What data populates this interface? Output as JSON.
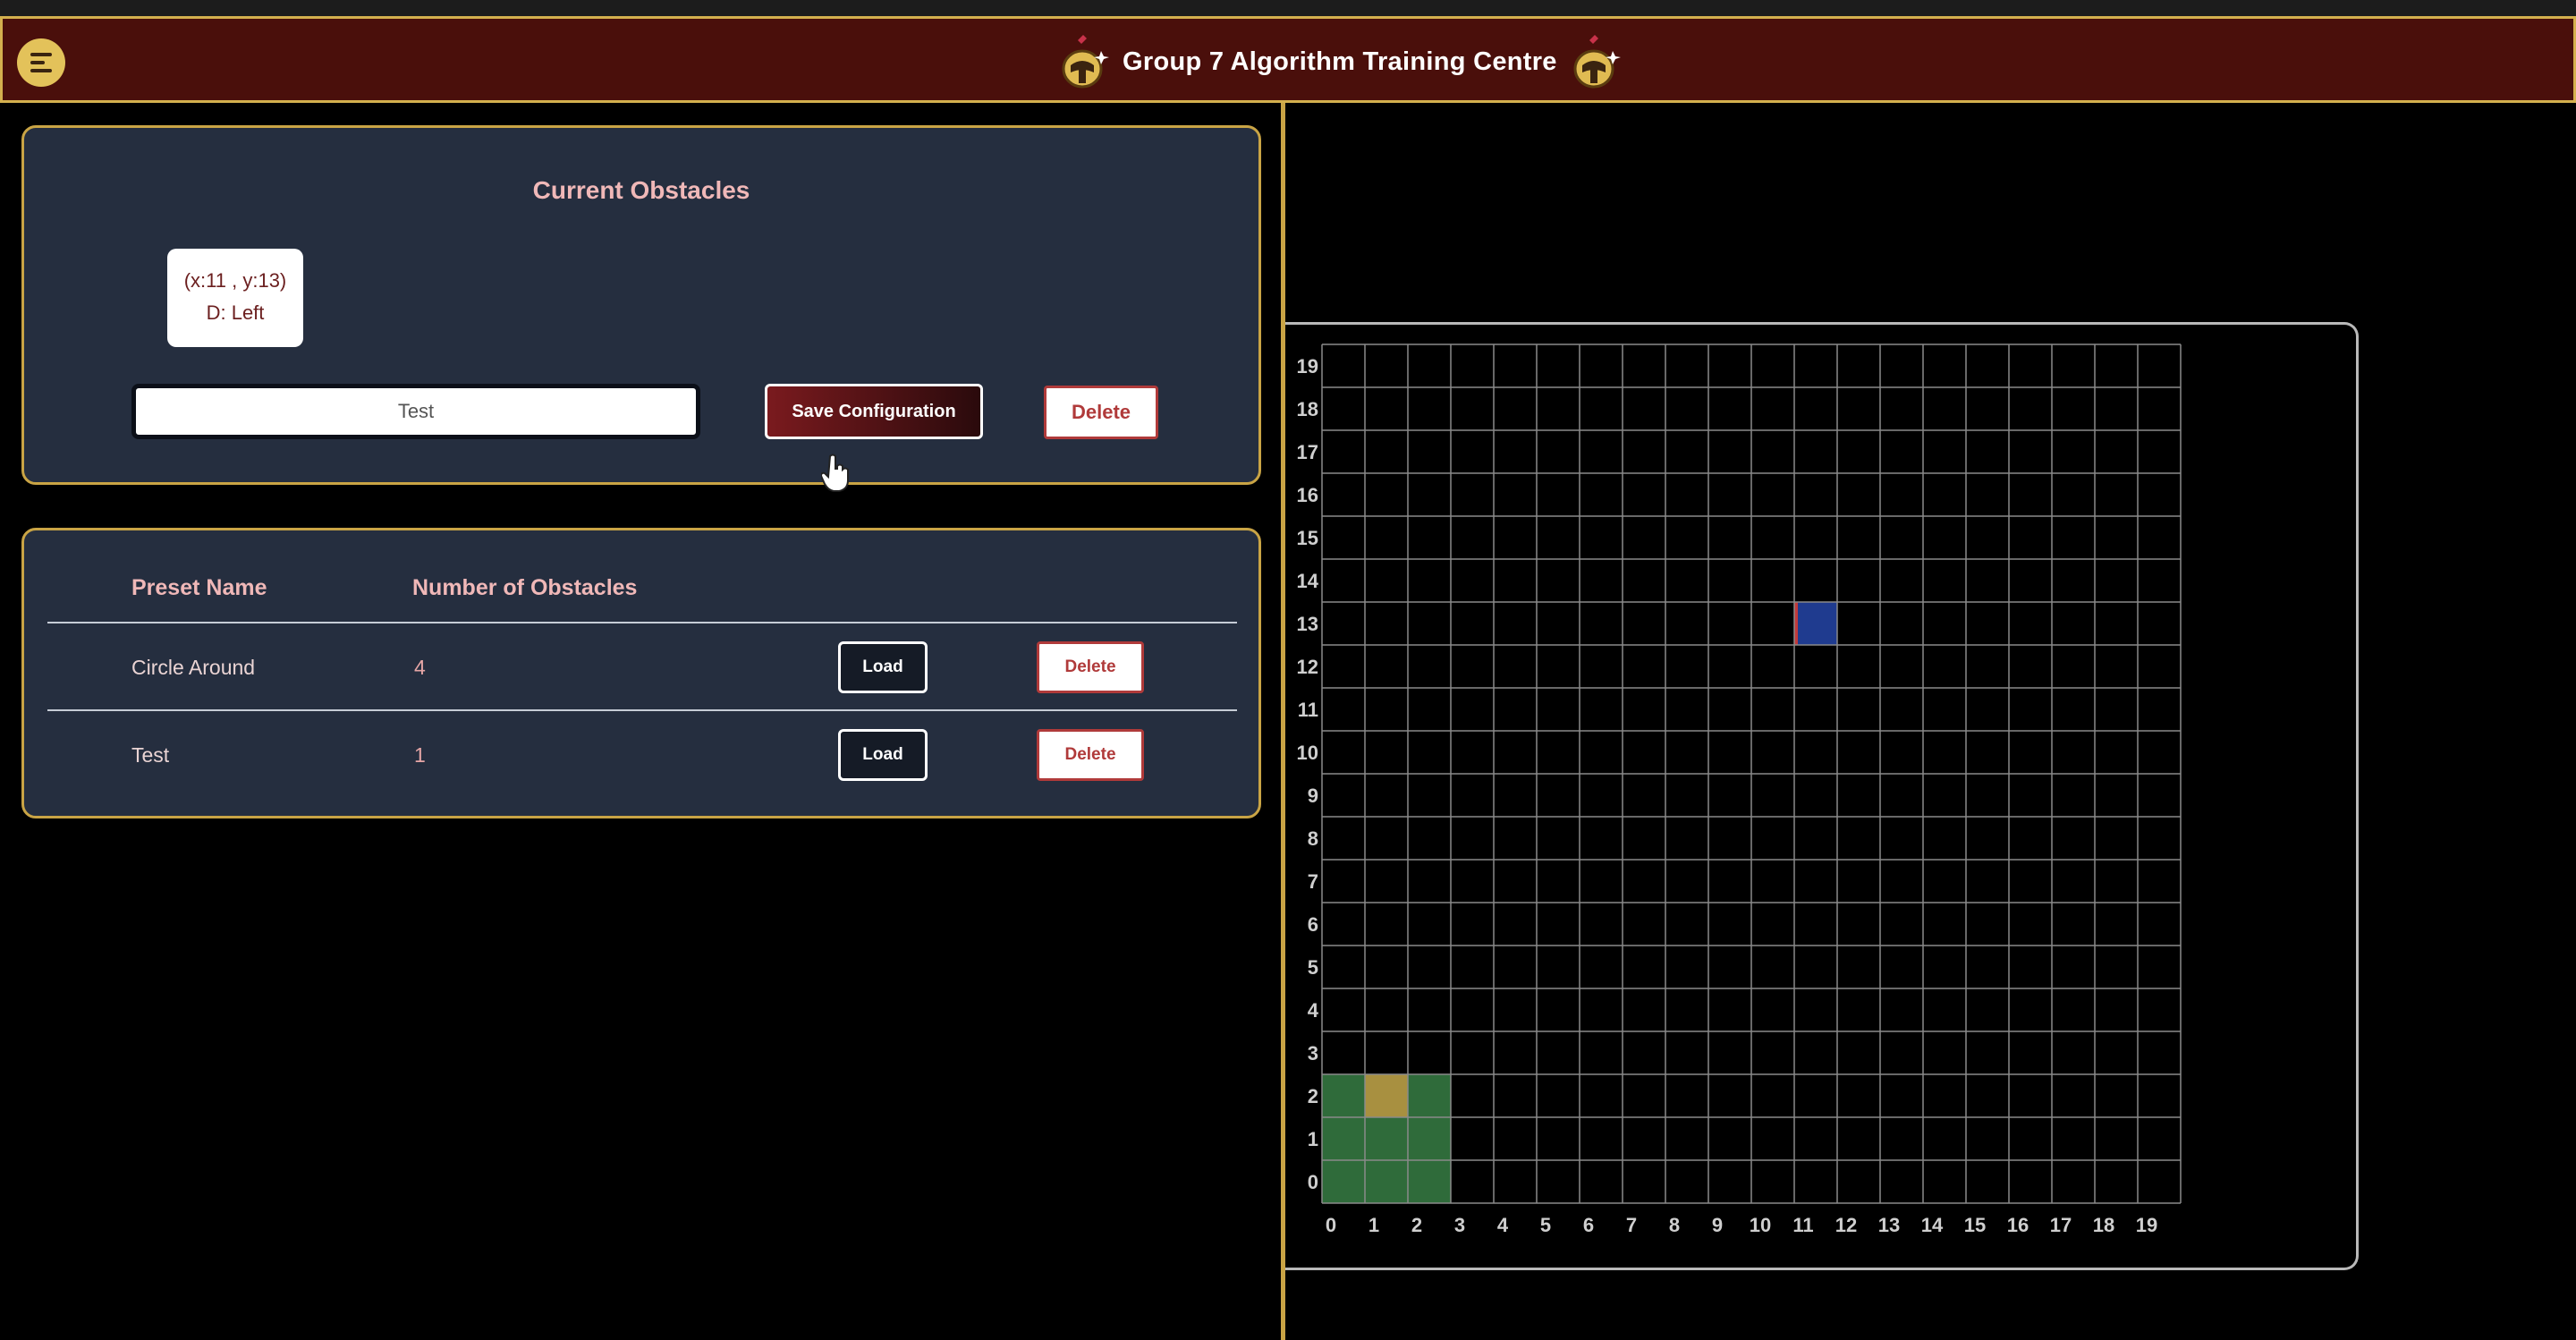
{
  "header": {
    "title": "Group 7 Algorithm Training Centre",
    "menu_icon": "hamburger-icon",
    "logo_icon": "helmet-icon"
  },
  "current_obstacles": {
    "title": "Current Obstacles",
    "obstacles": [
      {
        "coords": "(x:11 , y:13)",
        "direction": "D: Left"
      }
    ],
    "name_input_value": "Test",
    "save_label": "Save Configuration",
    "delete_label": "Delete"
  },
  "presets": {
    "headers": {
      "name": "Preset Name",
      "count": "Number of Obstacles"
    },
    "rows": [
      {
        "name": "Circle Around",
        "count": "4",
        "load_label": "Load",
        "delete_label": "Delete"
      },
      {
        "name": "Test",
        "count": "1",
        "load_label": "Load",
        "delete_label": "Delete"
      }
    ]
  },
  "grid": {
    "size": 20,
    "x_labels": [
      "0",
      "1",
      "2",
      "3",
      "4",
      "5",
      "6",
      "7",
      "8",
      "9",
      "10",
      "11",
      "12",
      "13",
      "14",
      "15",
      "16",
      "17",
      "18",
      "19"
    ],
    "y_labels": [
      "19",
      "18",
      "17",
      "16",
      "15",
      "14",
      "13",
      "12",
      "11",
      "10",
      "9",
      "8",
      "7",
      "6",
      "5",
      "4",
      "3",
      "2",
      "1",
      "0"
    ],
    "start_cells": [
      [
        0,
        0
      ],
      [
        1,
        0
      ],
      [
        2,
        0
      ],
      [
        0,
        1
      ],
      [
        1,
        1
      ],
      [
        2,
        1
      ],
      [
        0,
        2
      ],
      [
        2,
        2
      ]
    ],
    "robot_cell": [
      1,
      2
    ],
    "obstacle": {
      "x": 11,
      "y": 13,
      "face": "left"
    },
    "colors": {
      "start": "#2f6b3a",
      "robot": "#a89040",
      "obstacle": "#1f3b8f",
      "obstacle_face": "#c23a3a",
      "grid_line": "#8a8a8a",
      "label": "#cfcfcf"
    }
  },
  "colors": {
    "accent": "#c9a445",
    "header_bg": "#4a0f0b",
    "panel_bg": "#252e3f"
  }
}
